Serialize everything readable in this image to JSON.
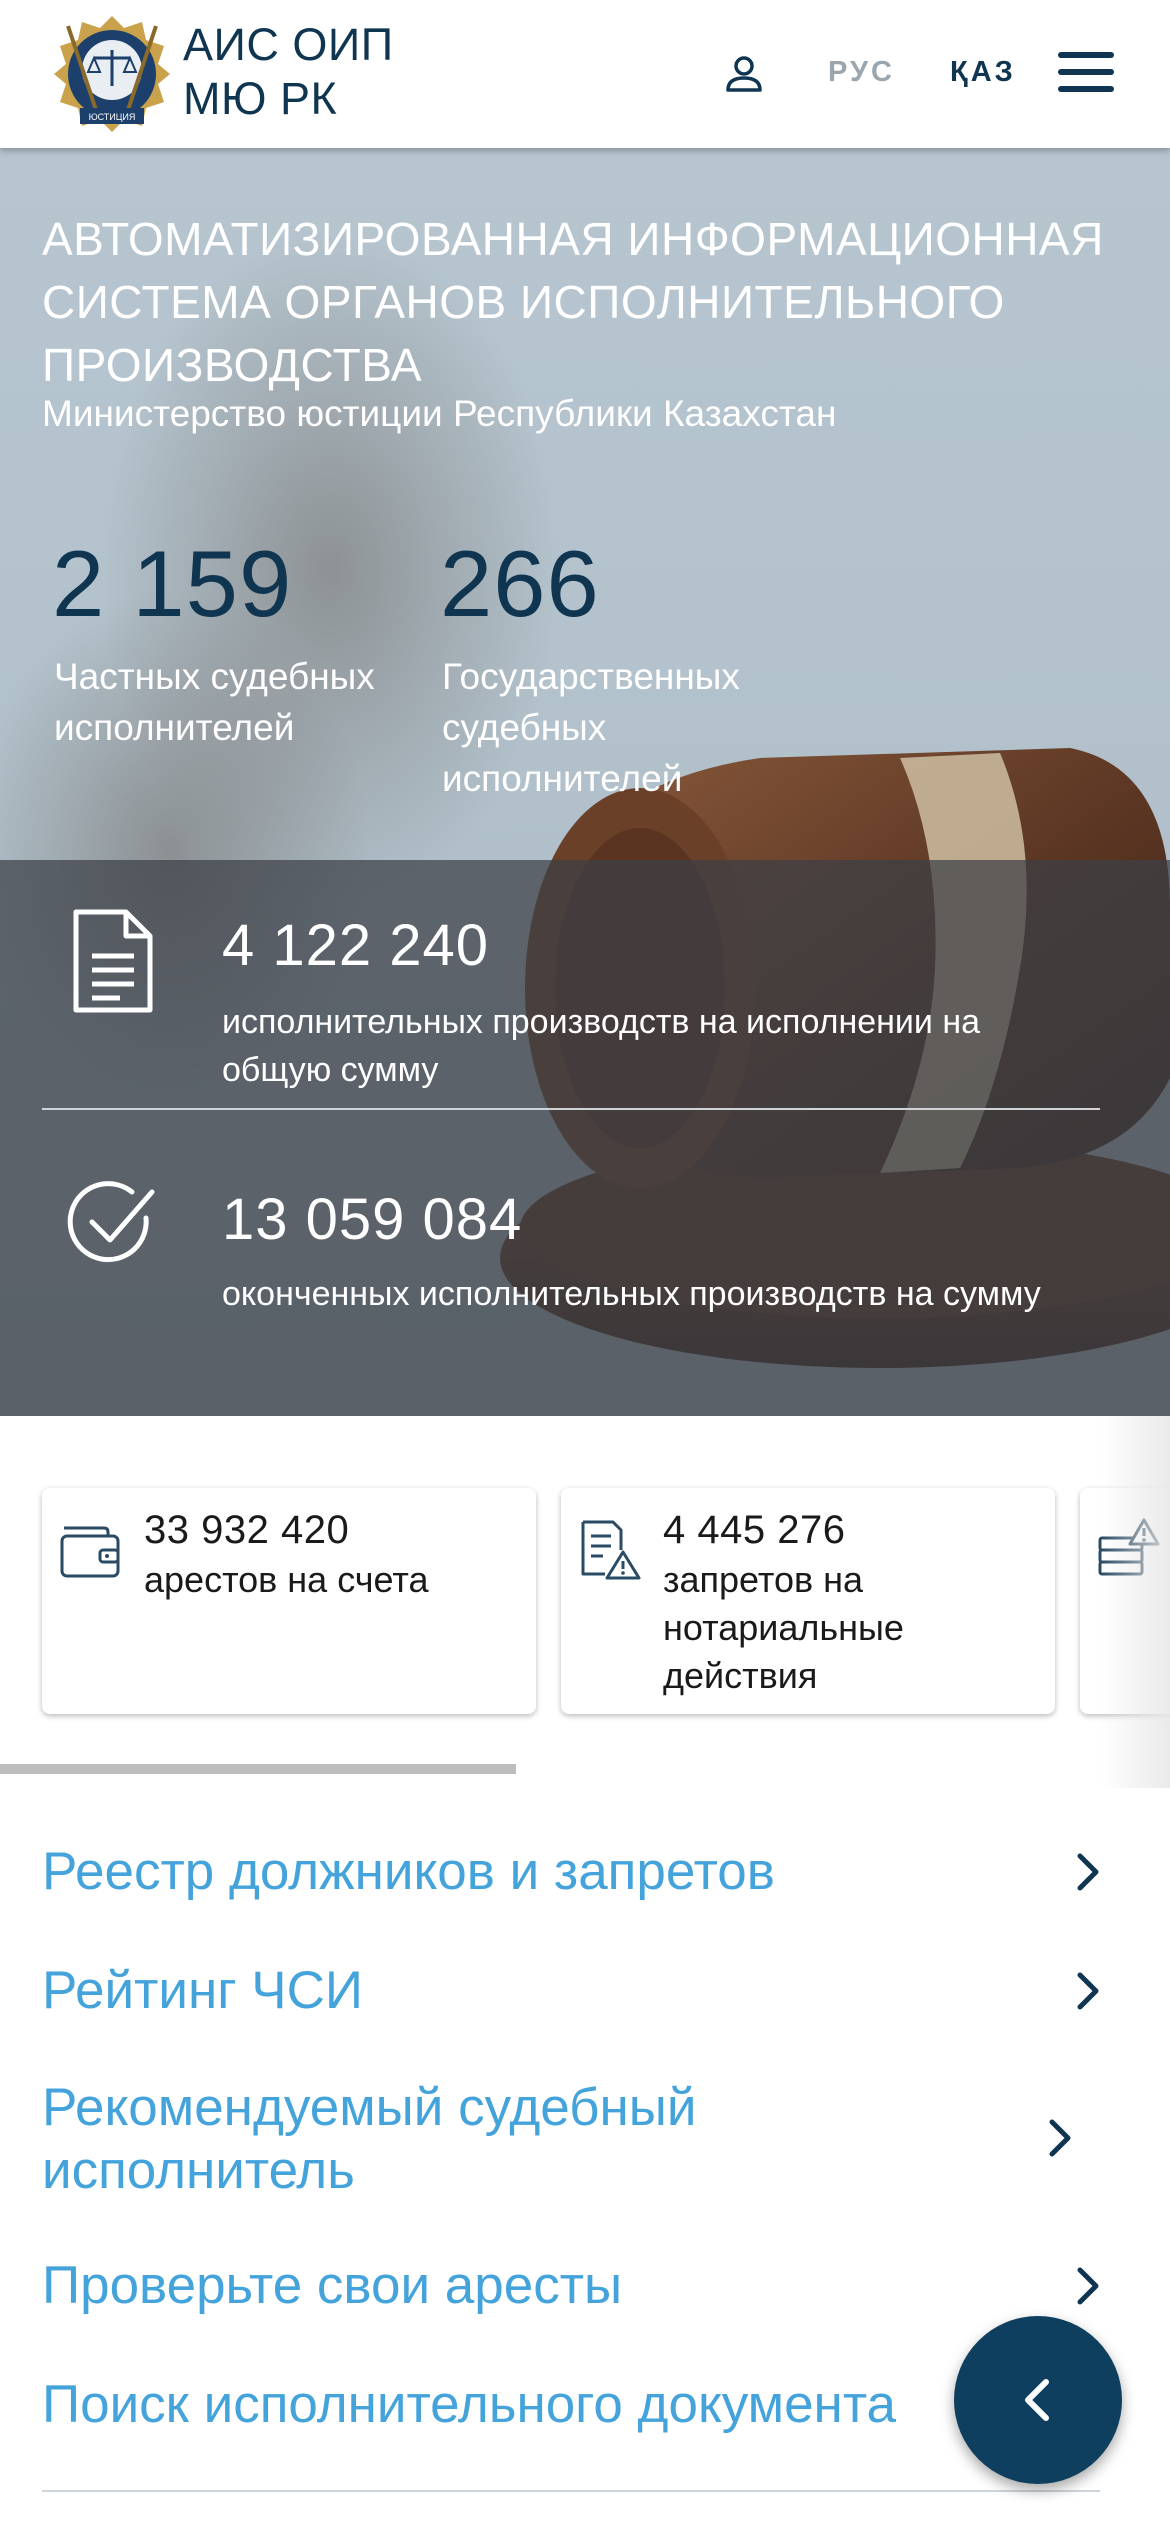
{
  "header": {
    "logo_line1": "АИС ОИП",
    "logo_line2": "МЮ РК",
    "logo_emblem_text": "ЮСТИЦИЯ",
    "lang_ru": "РУС",
    "lang_kz": "ҚАЗ",
    "icons": {
      "emblem": "justice-emblem-icon",
      "user": "user-icon",
      "menu": "hamburger-menu-icon"
    }
  },
  "hero": {
    "title": "АВТОМАТИЗИРОВАННАЯ ИНФОРМАЦИОННАЯ СИСТЕМА ОРГАНОВ ИСПОЛНИТЕЛЬНОГО ПРОИЗВОДСТВА",
    "subtitle": "Министерство юстиции Республики Казахстан",
    "private_count": "2 159",
    "private_label": "Частных судебных исполнителей",
    "state_count": "266",
    "state_label": "Государственных судебных исполнителей"
  },
  "stats": [
    {
      "icon": "document-icon",
      "value": "4 122 240",
      "description": "исполнительных производств на исполнении на общую сумму"
    },
    {
      "icon": "check-circle-icon",
      "value": "13 059 084",
      "description": "оконченных исполнительных производств на сумму"
    }
  ],
  "cards": [
    {
      "icon": "wallet-icon",
      "value": "33 932 420",
      "label": "арестов на счета"
    },
    {
      "icon": "notary-warning-icon",
      "value": "4 445 276",
      "label": "запретов на нотариальные действия"
    },
    {
      "icon": "stack-warning-icon",
      "value": "",
      "label": ""
    }
  ],
  "links": [
    {
      "label": "Реестр должников и запретов"
    },
    {
      "label": "Рейтинг ЧСИ"
    },
    {
      "label": "Рекомендуемый судебный исполнитель"
    },
    {
      "label": "Проверьте свои аресты"
    },
    {
      "label": "Поиск исполнительного документа"
    }
  ],
  "colors": {
    "brand_dark": "#0f3550",
    "link_blue": "#45a3dc",
    "fab": "#0f3f5f"
  }
}
